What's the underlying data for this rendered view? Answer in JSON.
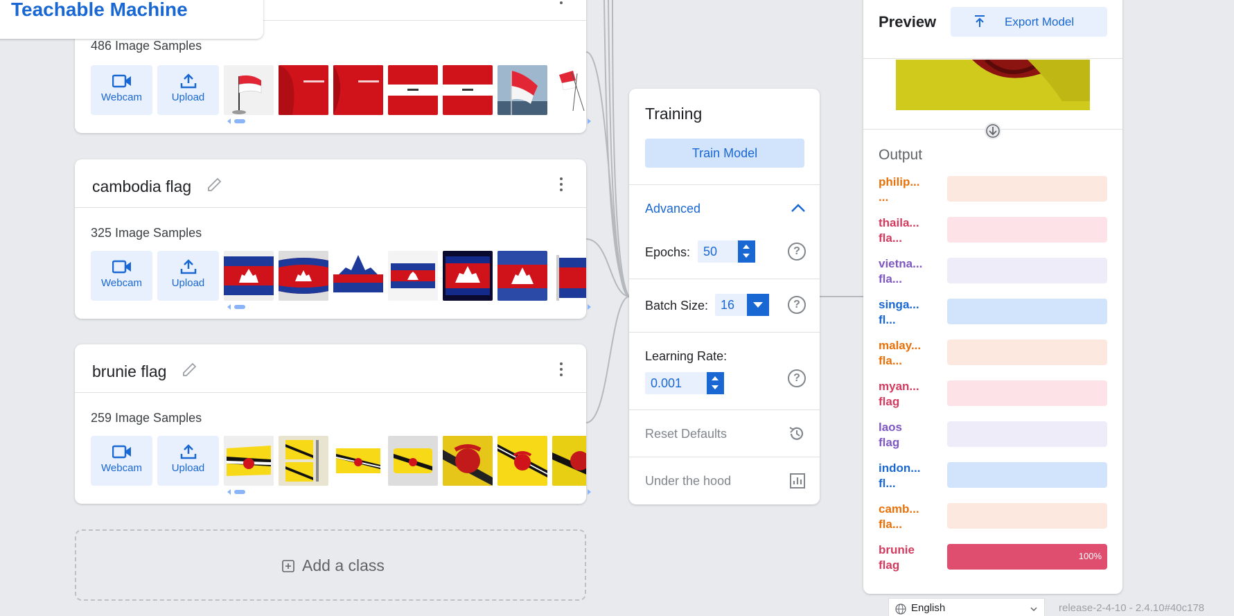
{
  "app": {
    "title": "Teachable Machine"
  },
  "classes": [
    {
      "name": "",
      "samples": "486 Image Samples",
      "webcam": "Webcam",
      "upload": "Upload"
    },
    {
      "name": "cambodia flag",
      "samples": "325 Image Samples",
      "webcam": "Webcam",
      "upload": "Upload"
    },
    {
      "name": "brunie flag",
      "samples": "259 Image Samples",
      "webcam": "Webcam",
      "upload": "Upload"
    }
  ],
  "add_class": "Add a class",
  "training": {
    "title": "Training",
    "train_button": "Train Model",
    "advanced": "Advanced",
    "epochs_label": "Epochs:",
    "epochs_value": "50",
    "batch_label": "Batch Size:",
    "batch_value": "16",
    "lr_label": "Learning Rate:",
    "lr_value": "0.001",
    "reset": "Reset Defaults",
    "hood": "Under the hood",
    "help_glyph": "?"
  },
  "preview": {
    "title": "Preview",
    "export_button": "Export Model",
    "output_title": "Output",
    "outputs": [
      {
        "l1": "philip...",
        "l2": "...",
        "color": "#e8710a",
        "bg": "#fde8df",
        "confidence": 0
      },
      {
        "l1": "thaila...",
        "l2": "fla...",
        "color": "#d33b5e",
        "bg": "#fde2e7",
        "confidence": 0
      },
      {
        "l1": "vietna...",
        "l2": "fla...",
        "color": "#7e57c2",
        "bg": "#eeecf9",
        "confidence": 0
      },
      {
        "l1": "singa...",
        "l2": "fl...",
        "color": "#1967d2",
        "bg": "#d2e3fc",
        "confidence": 0
      },
      {
        "l1": "malay...",
        "l2": "fla...",
        "color": "#e8710a",
        "bg": "#fde8df",
        "confidence": 0
      },
      {
        "l1": "myan...",
        "l2": "flag",
        "color": "#d33b5e",
        "bg": "#fde2e7",
        "confidence": 0
      },
      {
        "l1": "laos",
        "l2": "flag",
        "color": "#7e57c2",
        "bg": "#eeecf9",
        "confidence": 0
      },
      {
        "l1": "indon...",
        "l2": "fl...",
        "color": "#1967d2",
        "bg": "#d2e3fc",
        "confidence": 0
      },
      {
        "l1": "camb...",
        "l2": "fla...",
        "color": "#e8710a",
        "bg": "#fde8df",
        "confidence": 0
      },
      {
        "l1": "brunie",
        "l2": "flag",
        "color": "#d33b5e",
        "bg": "#e04e6f",
        "confidence": 100,
        "pct": "100%"
      }
    ]
  },
  "footer": {
    "language": "English",
    "release": "release-2-4-10 - 2.4.10#40c178"
  },
  "thumb_sets": [
    [
      "indo-hand",
      "indo-red1",
      "indo-red2",
      "indo-stripe1",
      "indo-stripe2",
      "indo-sky",
      "indo-small"
    ],
    [
      "camb1",
      "camb2",
      "camb3",
      "camb4",
      "camb5",
      "camb6",
      "camb7"
    ],
    [
      "brun1",
      "brun2",
      "brun3",
      "brun4",
      "brun5",
      "brun6",
      "brun7"
    ]
  ]
}
